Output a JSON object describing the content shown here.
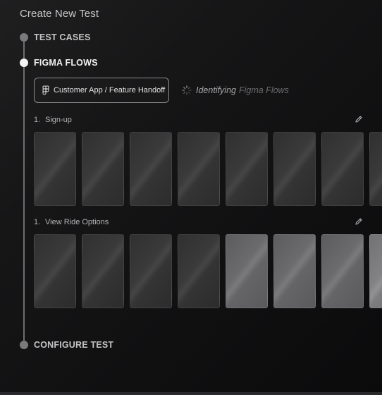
{
  "page": {
    "title": "Create New Test"
  },
  "steps": [
    {
      "label": "TEST CASES",
      "state": "complete"
    },
    {
      "label": "FIGMA FLOWS",
      "state": "active"
    },
    {
      "label": "CONFIGURE TEST",
      "state": "pending"
    }
  ],
  "figma": {
    "file_label": "Customer App / Feature Handoff",
    "status_strong": "Identifying",
    "status_soft": "Figma Flows",
    "icon": "figma-icon",
    "spinner_icon": "spinner-icon"
  },
  "flows": [
    {
      "number": "1.",
      "name": "Sign-up",
      "edit_icon": "pencil-icon",
      "frames": [
        "dark",
        "dark",
        "dark",
        "dark",
        "dark",
        "dark",
        "dark",
        "dark"
      ]
    },
    {
      "number": "1.",
      "name": "View Ride Options",
      "edit_icon": "pencil-icon",
      "frames": [
        "dark",
        "dark",
        "dark",
        "dark",
        "light",
        "light",
        "light",
        "lighter"
      ]
    }
  ],
  "colors": {
    "background": "#121213",
    "active_dot": "#f4f4f5",
    "inactive_dot": "#7a7a7d",
    "timeline": "#6e6e71",
    "chip_border": "#8c8c8f"
  }
}
